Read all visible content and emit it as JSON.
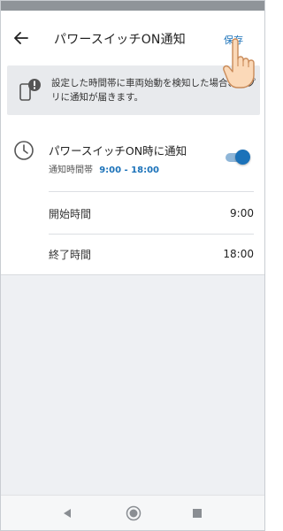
{
  "header": {
    "title": "パワースイッチON通知",
    "save_label": "保存",
    "back_icon": "arrow-left-icon"
  },
  "info": {
    "icon": "phone-alert-icon",
    "text": "設定した時間帯に車両始動を検知した場合、アプリに通知が届きます。"
  },
  "setting": {
    "icon": "clock-icon",
    "title": "パワースイッチON時に通知",
    "period_label": "通知時間帯",
    "period_value": "9:00 - 18:00",
    "enabled": true
  },
  "times": [
    {
      "label": "開始時間",
      "value": "9:00"
    },
    {
      "label": "終了時間",
      "value": "18:00"
    }
  ],
  "nav": {
    "back_icon": "triangle-back-icon",
    "home_icon": "circle-home-icon",
    "recent_icon": "square-recent-icon"
  },
  "colors": {
    "accent": "#1b72b9",
    "toggle_track": "#8fb6d8",
    "info_bg": "#e8eaed",
    "page_bg": "#eef0f3"
  }
}
